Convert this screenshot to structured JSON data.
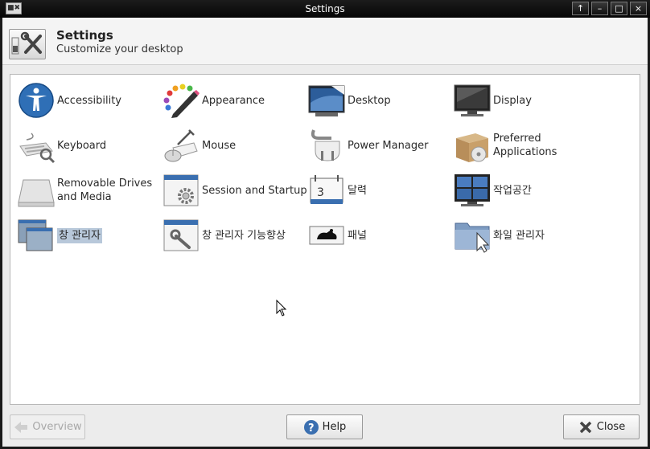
{
  "window": {
    "title": "Settings",
    "menu_glyph": "■✖",
    "controls": {
      "shade": "↑",
      "minimize": "–",
      "maximize": "□",
      "close": "×"
    }
  },
  "header": {
    "title": "Settings",
    "subtitle": "Customize your desktop",
    "icon": "settings-tools-icon"
  },
  "items": [
    {
      "label": "Accessibility",
      "icon": "accessibility-icon"
    },
    {
      "label": "Appearance",
      "icon": "appearance-palette-icon"
    },
    {
      "label": "Desktop",
      "icon": "desktop-icon"
    },
    {
      "label": "Display",
      "icon": "display-monitor-icon"
    },
    {
      "label": "Keyboard",
      "icon": "keyboard-icon"
    },
    {
      "label": "Mouse",
      "icon": "mouse-icon"
    },
    {
      "label": "Power Manager",
      "icon": "power-plug-icon"
    },
    {
      "label": "Preferred\nApplications",
      "icon": "preferred-applications-icon"
    },
    {
      "label": "Removable Drives\nand Media",
      "icon": "removable-drive-icon"
    },
    {
      "label": "Session and Startup",
      "icon": "session-gear-icon"
    },
    {
      "label": "달력",
      "icon": "calendar-icon"
    },
    {
      "label": "작업공간",
      "icon": "workspaces-icon"
    },
    {
      "label": "창 관리자",
      "icon": "window-manager-icon"
    },
    {
      "label": "창 관리자 기능향상",
      "icon": "window-manager-tweaks-icon"
    },
    {
      "label": "패널",
      "icon": "panel-icon"
    },
    {
      "label": "화일 관리자",
      "icon": "file-manager-icon"
    }
  ],
  "footer": {
    "overview": "Overview",
    "help": "Help",
    "close": "Close"
  },
  "colors": {
    "titlebar": "#0a0a0a",
    "selection": "#b8c8da",
    "disabled_text": "#a8a8a8"
  }
}
